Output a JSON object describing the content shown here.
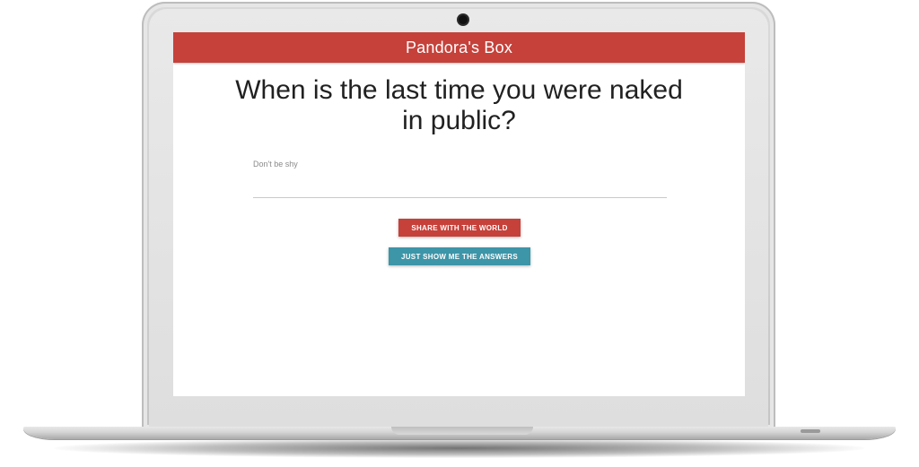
{
  "app": {
    "title": "Pandora's Box"
  },
  "question": {
    "text": "When is the last time you were naked in public?"
  },
  "answer_field": {
    "hint": "Don't be shy",
    "value": ""
  },
  "buttons": {
    "share_label": "SHARE WITH THE WORLD",
    "answers_label": "JUST SHOW ME THE ANSWERS"
  },
  "colors": {
    "accent_red": "#c5413a",
    "accent_teal": "#3d95a8",
    "text_dark": "#212121",
    "hint_grey": "#8a8a8a"
  }
}
